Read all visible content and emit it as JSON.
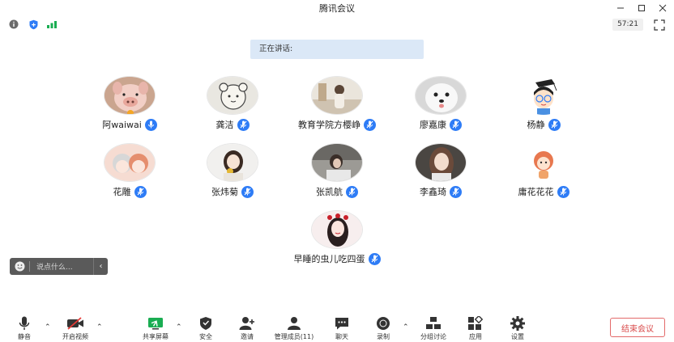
{
  "window": {
    "title": "腾讯会议"
  },
  "status": {
    "timer": "57:21"
  },
  "banner": {
    "speaking_label": "正在讲话:"
  },
  "participants": [
    {
      "name": "阿waiwai"
    },
    {
      "name": "龚洁"
    },
    {
      "name": "教育学院方樱峥"
    },
    {
      "name": "廖嘉康"
    },
    {
      "name": "杨静"
    },
    {
      "name": "花雕"
    },
    {
      "name": "张炜菊"
    },
    {
      "name": "张凯航"
    },
    {
      "name": "李鑫琦"
    },
    {
      "name": "庸花花花"
    },
    {
      "name": "早睡的虫儿吃四蛋"
    }
  ],
  "chat": {
    "placeholder": "说点什么..."
  },
  "toolbar": {
    "mute": "静音",
    "video": "开启视频",
    "share": "共享屏幕",
    "security": "安全",
    "invite": "邀请",
    "members": "管理成员(11)",
    "chat": "聊天",
    "record": "录制",
    "breakout": "分组讨论",
    "apps": "应用",
    "settings": "设置",
    "end": "结束会议"
  },
  "colors": {
    "accent": "#2e7cf6",
    "end": "#d94a4a",
    "banner": "#dbe8f7",
    "share_green": "#1aad52"
  }
}
